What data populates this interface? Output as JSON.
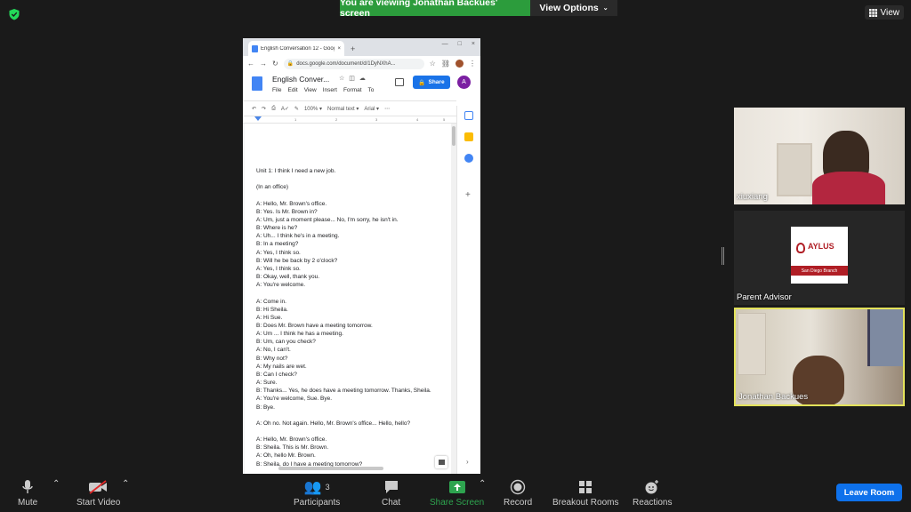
{
  "banner": {
    "text": "You are viewing Jonathan Backues' screen",
    "color": "#2c9c3c"
  },
  "view_options": {
    "label": "View Options"
  },
  "view_button": {
    "label": "View"
  },
  "browser": {
    "tab_title": "English Conversation 12 - Googl",
    "url": "docs.google.com/document/d/1DyNXhA...",
    "doc_title": "English Conver...",
    "menus": [
      "File",
      "Edit",
      "View",
      "Insert",
      "Format",
      "To"
    ],
    "share_label": "Share",
    "account_initial": "A",
    "zoom": "100%",
    "style": "Normal text",
    "font": "Arial",
    "ruler_marks": [
      "1",
      "2",
      "3",
      "4",
      "5"
    ]
  },
  "document": {
    "lines": [
      "Unit 1: I think I need a new job.",
      "",
      "(In an office)",
      "",
      "A: Hello, Mr. Brown's office.",
      "B: Yes. Is Mr. Brown in?",
      "A: Um, just a moment please... No, I'm sorry, he isn't in.",
      "B: Where is he?",
      "A: Uh... I think he's in a meeting.",
      "B: In a meeting?",
      "A: Yes, I think so.",
      "B: Will he be back by 2 o'clock?",
      "A: Yes, I think so.",
      "B: Okay, well, thank you.",
      "A: You're welcome.",
      "",
      "A: Come in.",
      "B: Hi Sheila.",
      "A: Hi Sue.",
      "B: Does Mr. Brown have a meeting tomorrow.",
      "A: Um ... I think he has a meeting.",
      "B: Um, can you check?",
      "A: No, I can't.",
      "B: Why not?",
      "A: My nails are wet.",
      "B: Can I check?",
      "A: Sure.",
      "B: Thanks... Yes, he does have a meeting tomorrow. Thanks, Sheila.",
      "A: You're welcome, Sue. Bye.",
      "B: Bye.",
      "",
      "A: Oh no. Not again. Hello, Mr. Brown's office... Hello, hello?",
      "",
      "A: Hello, Mr. Brown's office.",
      "B: Sheila. This is Mr. Brown.",
      "A: Oh, hello Mr. Brown.",
      "B: Sheila, do I have a meeting tomorrow?"
    ]
  },
  "participants_tiles": [
    {
      "name": "xiuxiang"
    },
    {
      "name": "Parent Advisor",
      "logo_brand": "AYLUS",
      "logo_band": "San Diego Branch"
    },
    {
      "name": "Jonathan Backues",
      "active_speaker_color": "#e3e25a"
    }
  ],
  "controls": {
    "mute": "Mute",
    "start_video": "Start Video",
    "participants": "Participants",
    "participants_count": "3",
    "chat": "Chat",
    "share_screen": "Share Screen",
    "record": "Record",
    "breakout_rooms": "Breakout Rooms",
    "reactions": "Reactions",
    "leave_room": "Leave Room",
    "share_color": "#2ea44f",
    "leave_color": "#0e71eb"
  }
}
